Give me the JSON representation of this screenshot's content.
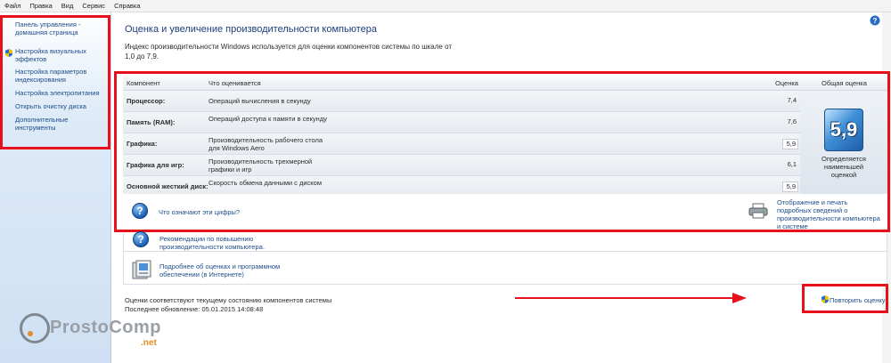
{
  "menu": [
    "Файл",
    "Правка",
    "Вид",
    "Сервис",
    "Справка"
  ],
  "sidebar": {
    "items": [
      {
        "label": "Панель управления - домашняя страница"
      },
      {
        "label": "Настройка визуальных эффектов"
      },
      {
        "label": "Настройка параметров индексирования"
      },
      {
        "label": "Настройка электропитания"
      },
      {
        "label": "Открыть очистку диска"
      },
      {
        "label": "Дополнительные инструменты"
      }
    ]
  },
  "logo": {
    "brand": "ProstoComp",
    "suffix": ".net"
  },
  "header": {
    "title": "Оценка и увеличение производительности компьютера",
    "intro": "Индекс производительности Windows используется для оценки компонентов системы по шкале от 1,0 до 7,9."
  },
  "table": {
    "headers": {
      "component": "Компонент",
      "what": "Что оценивается",
      "score": "Оценка",
      "overall": "Общая оценка"
    },
    "rows": [
      {
        "component": "Процессор:",
        "what": "Операций вычисления в секунду",
        "score": "7,4"
      },
      {
        "component": "Память (RAM):",
        "what": "Операций доступа к памяти в секунду",
        "score": "7,6"
      },
      {
        "component": "Графика:",
        "what": "Производительность рабочего стола для Windows Aero",
        "score": "5,9"
      },
      {
        "component": "Графика для игр:",
        "what": "Производительность трехмерной графики и игр",
        "score": "6,1"
      },
      {
        "component": "Основной жесткий диск:",
        "what": "Скорость обмена данными с диском",
        "score": "5,9"
      }
    ],
    "overall_score": "5,9",
    "overall_note": "Определяется наименьшей оценкой"
  },
  "links": {
    "what_mean": "Что означают эти цифры?",
    "print": "Отображение и печать подробных сведений о производительности компьютера и системе",
    "tips": "Рекомендации по повышению производительности компьютера.",
    "more": "Подробнее об оценках и программном обеспечении (в Интернете)"
  },
  "status": {
    "current": "Оценки соответствуют текущему состоянию компонентов системы",
    "last_update": "Последнее обновление: 05.01.2015 14:08:48",
    "rerun": "Повторить оценку"
  },
  "colors": {
    "highlight": "#e8101b",
    "link": "#1c4d8a",
    "title": "#1d3e7b"
  }
}
